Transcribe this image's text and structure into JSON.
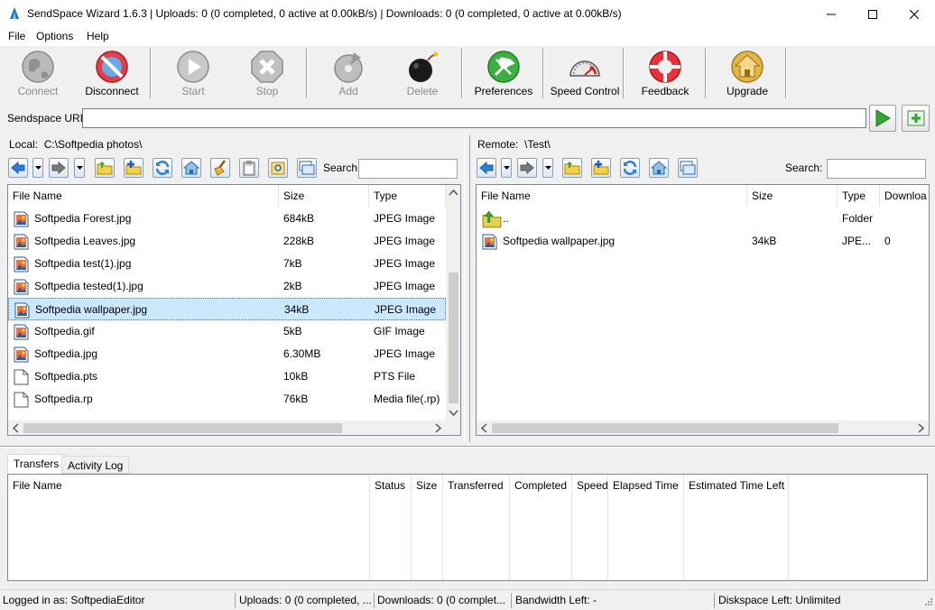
{
  "window": {
    "title": "SendSpace Wizard 1.6.3 | Uploads: 0 (0 completed, 0 active at 0.00kB/s) | Downloads: 0 (0 completed, 0 active at 0.00kB/s)"
  },
  "menu": [
    "File",
    "Options",
    "Help"
  ],
  "toolbar": {
    "connect": "Connect",
    "disconnect": "Disconnect",
    "start": "Start",
    "stop": "Stop",
    "add": "Add",
    "delete": "Delete",
    "preferences": "Preferences",
    "speed_control": "Speed Control",
    "feedback": "Feedback",
    "upgrade": "Upgrade"
  },
  "url": {
    "label": "Sendspace URL:",
    "value": ""
  },
  "local": {
    "label": "Local:",
    "path": "C:\\Softpedia photos\\",
    "search_label": "Search:",
    "columns": [
      "File Name",
      "Size",
      "Type"
    ],
    "files": [
      {
        "name": "Softpedia Forest.jpg",
        "size": "684kB",
        "type": "JPEG Image",
        "icon": "image-file-icon"
      },
      {
        "name": "Softpedia Leaves.jpg",
        "size": "228kB",
        "type": "JPEG Image",
        "icon": "image-file-icon"
      },
      {
        "name": "Softpedia test(1).jpg",
        "size": "7kB",
        "type": "JPEG Image",
        "icon": "image-file-icon"
      },
      {
        "name": "Softpedia tested(1).jpg",
        "size": "2kB",
        "type": "JPEG Image",
        "icon": "image-file-icon"
      },
      {
        "name": "Softpedia wallpaper.jpg",
        "size": "34kB",
        "type": "JPEG Image",
        "icon": "image-file-icon",
        "selected": true
      },
      {
        "name": "Softpedia.gif",
        "size": "5kB",
        "type": "GIF Image",
        "icon": "image-file-icon"
      },
      {
        "name": "Softpedia.jpg",
        "size": "6.30MB",
        "type": "JPEG Image",
        "icon": "image-file-icon"
      },
      {
        "name": "Softpedia.pts",
        "size": "10kB",
        "type": "PTS File",
        "icon": "blank-file-icon"
      },
      {
        "name": "Softpedia.rp",
        "size": "76kB",
        "type": "Media file(.rp)",
        "icon": "blank-file-icon"
      }
    ]
  },
  "remote": {
    "label": "Remote:",
    "path": "\\Test\\",
    "search_label": "Search:",
    "columns": [
      "File Name",
      "Size",
      "Type",
      "Downloa"
    ],
    "files": [
      {
        "name": "..",
        "size": "",
        "type": "Folder",
        "downloads": "",
        "icon": "folder-up-icon"
      },
      {
        "name": "Softpedia wallpaper.jpg",
        "size": "34kB",
        "type": "JPE...",
        "downloads": "0",
        "icon": "image-file-icon"
      }
    ]
  },
  "transfers": {
    "tabs": [
      "Transfers",
      "Activity Log"
    ],
    "columns": [
      "File Name",
      "Status",
      "Size",
      "Transferred",
      "Completed",
      "Speed",
      "Elapsed Time",
      "Estimated Time Left"
    ]
  },
  "status": {
    "logged_in": "Logged in as: SoftpediaEditor",
    "uploads": "Uploads: 0 (0 completed, ...",
    "downloads": "Downloads: 0 (0 complet...",
    "bandwidth": "Bandwidth Left: -",
    "diskspace": "Diskspace Left: Unlimited"
  },
  "colors": {
    "selection": "#cce8ff",
    "accent_green": "#2fa53a",
    "accent_red": "#d8232a"
  }
}
